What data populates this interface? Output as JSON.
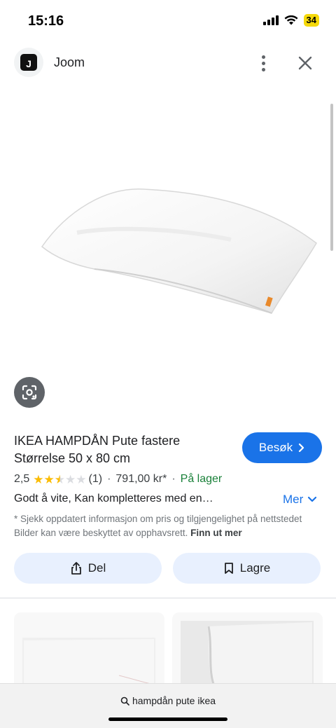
{
  "status": {
    "time": "15:16",
    "battery": "34"
  },
  "header": {
    "app_name": "Joom",
    "logo_letter": "J"
  },
  "product": {
    "title_line1": "IKEA HAMPDÅN Pute fastere",
    "title_line2": "Størrelse 50 x 80 cm",
    "rating_value": "2,5",
    "rating_stars": 2.5,
    "review_count": "(1)",
    "price": "791,00 kr*",
    "stock": "På lager",
    "description": "Godt å vite, Kan kompletteres med en…",
    "more_label": "Mer",
    "disclaimer": "* Sjekk oppdatert informasjon om pris og tilgjengelighet på nettstedet Bilder kan være beskyttet av opphavsrett.",
    "disclaimer_link": "Finn ut mer"
  },
  "actions": {
    "visit_label": "Besøk",
    "share_label": "Del",
    "save_label": "Lagre"
  },
  "search": {
    "query": "hampdån pute ikea"
  },
  "icons": {
    "signal": "signal-icon",
    "wifi": "wifi-icon",
    "more": "more-vert-icon",
    "close": "close-icon",
    "lens": "lens-icon",
    "chevron": "chevron-right-icon",
    "share": "share-icon",
    "bookmark": "bookmark-icon",
    "search": "search-icon"
  },
  "colors": {
    "accent": "#1a73e8",
    "stock": "#188038",
    "star": "#fbbc04",
    "button_bg": "#e8f0fe"
  }
}
